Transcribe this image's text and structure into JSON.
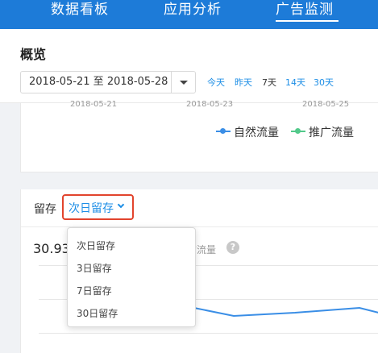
{
  "nav": {
    "tabs": [
      {
        "label": "数据看板"
      },
      {
        "label": "应用分析"
      },
      {
        "label": "广告监测",
        "active": true
      }
    ]
  },
  "overview": {
    "title": "概览",
    "date_range": "2018-05-21 至 2018-05-28",
    "quick_ranges": [
      "今天",
      "昨天",
      "7天",
      "14天",
      "30天"
    ],
    "active_quick_range": "7天"
  },
  "traffic_chart": {
    "x_ticks": [
      "2018-05-21",
      "2018-05-23",
      "2018-05-25"
    ],
    "legend": [
      {
        "name": "自然流量",
        "color": "#3a8ee6"
      },
      {
        "name": "推广流量",
        "color": "#52c98a"
      }
    ]
  },
  "retention": {
    "label": "留存",
    "selected": "次日留存",
    "value": "30.93%",
    "metric_label": "广流量",
    "options": [
      "次日留存",
      "3日留存",
      "7日留存",
      "30日留存"
    ],
    "line_color": "#3a8ee6"
  },
  "colors": {
    "nav_bg": "#1d7bd8",
    "link": "#1d8ee6",
    "highlight_border": "#e2442d"
  }
}
